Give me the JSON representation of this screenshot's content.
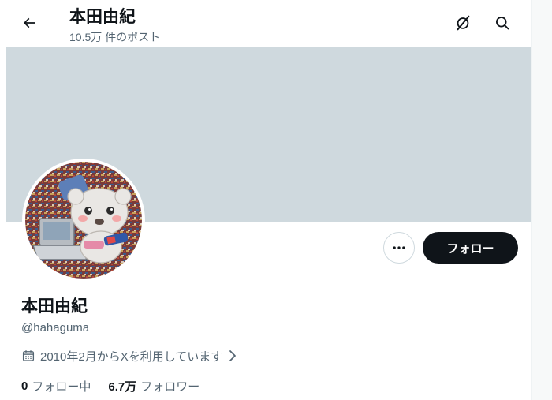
{
  "header": {
    "title": "本田由紀",
    "post_count": "10.5万 件のポスト",
    "icons": [
      "back-arrow-icon",
      "grok-icon",
      "search-icon"
    ]
  },
  "profile": {
    "display_name": "本田由紀",
    "handle": "@hahaguma",
    "joined": "2010年2月からXを利用しています",
    "following_count": "0",
    "following_label": "フォロー中",
    "followers_count": "6.7万",
    "followers_label": "フォロワー"
  },
  "actions": {
    "follow_label": "フォロー",
    "more_icon": "more-icon"
  },
  "colors": {
    "banner": "#cfd9de",
    "text_primary": "#0f1419",
    "text_secondary": "#536471",
    "follow_button_bg": "#0f1419",
    "follow_button_text": "#ffffff"
  }
}
